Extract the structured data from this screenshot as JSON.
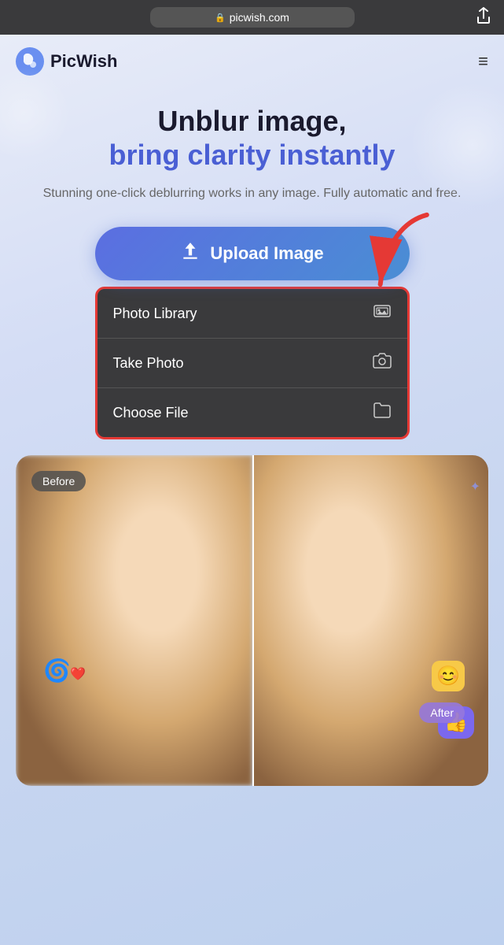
{
  "browser": {
    "url": "picwish.com",
    "lock_icon": "🔒"
  },
  "navbar": {
    "logo_text": "PicWish",
    "hamburger_icon": "≡"
  },
  "hero": {
    "title_line1": "Unblur image,",
    "title_line2": "bring clarity instantly",
    "subtitle": "Stunning one-click deblurring works in any image. Fully automatic and free.",
    "upload_button_label": "Upload Image",
    "upload_icon": "⬆"
  },
  "dropdown": {
    "items": [
      {
        "label": "Photo Library",
        "icon": "🖼"
      },
      {
        "label": "Take Photo",
        "icon": "📷"
      },
      {
        "label": "Choose File",
        "icon": "📁"
      }
    ]
  },
  "preview": {
    "before_label": "Before",
    "after_label": "After"
  }
}
